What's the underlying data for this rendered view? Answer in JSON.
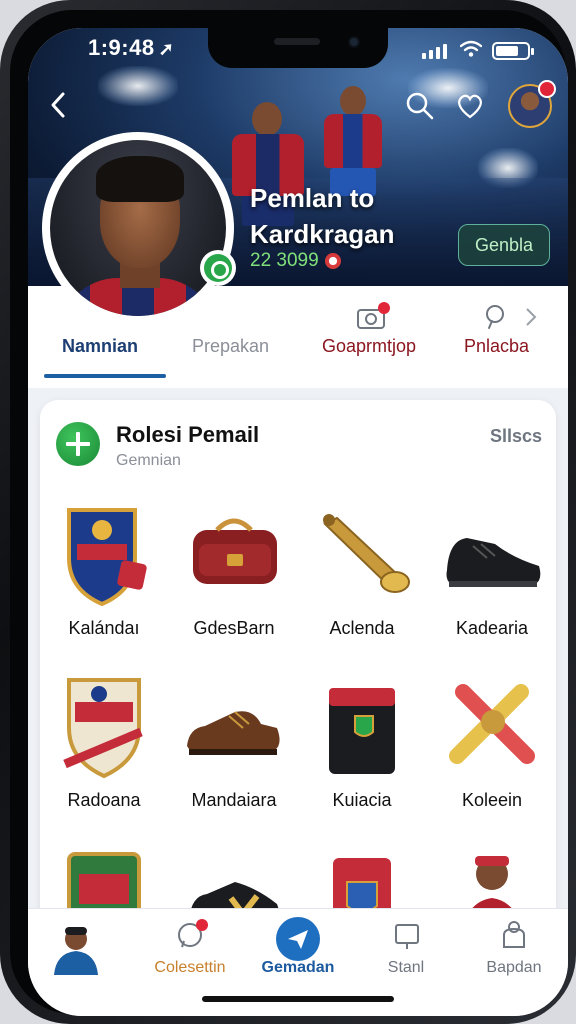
{
  "status_bar": {
    "time": "1:9:48",
    "nav_arrow": "➚"
  },
  "header": {
    "title_line1": "Pemlan to",
    "title_line2": "Kardkragan",
    "stat_value": "22 3099",
    "follow_label": "Genbla",
    "icons": [
      "back-icon",
      "search-icon",
      "heart-search-icon",
      "avatar-icon"
    ],
    "accent_color": "#1c5fa3"
  },
  "tabs": [
    {
      "label": "Namnian",
      "active": true,
      "color": "#1d3f74"
    },
    {
      "label": "Prepakan",
      "active": false,
      "color": "#8a8f98"
    },
    {
      "label": "Goaprmtjop",
      "active": false,
      "color": "#8b1620"
    },
    {
      "label": "Pnlacba",
      "active": false,
      "color": "#8b1620"
    }
  ],
  "card": {
    "title": "Rolesi Pemail",
    "subtitle": "Gemnian",
    "link": "Sllscs",
    "items": [
      {
        "label": "Kalándaı",
        "icon": "crest-shield-icon"
      },
      {
        "label": "GdesBarn",
        "icon": "leather-bag-icon"
      },
      {
        "label": "Aclenda",
        "icon": "bronze-horn-icon"
      },
      {
        "label": "Kadearia",
        "icon": "black-sneaker-icon"
      },
      {
        "label": "Radoana",
        "icon": "red-shield-icon"
      },
      {
        "label": "Mandaiara",
        "icon": "brown-boot-icon"
      },
      {
        "label": "Kuiacia",
        "icon": "black-bag-icon"
      },
      {
        "label": "Koleein",
        "icon": "crossed-scrolls-icon"
      },
      {
        "label": "",
        "icon": "green-badge-icon"
      },
      {
        "label": "",
        "icon": "black-cleat-icon"
      },
      {
        "label": "",
        "icon": "red-box-icon"
      },
      {
        "label": "",
        "icon": "player-figure-icon"
      }
    ]
  },
  "bottom_nav": [
    {
      "label": "",
      "icon": "player-avatar-icon"
    },
    {
      "label": "Colesettin",
      "icon": "chat-bubble-icon",
      "color": "#c7802b"
    },
    {
      "label": "Gemadan",
      "icon": "send-icon",
      "color": "#1d5a9f"
    },
    {
      "label": "Stanl",
      "icon": "message-square-icon",
      "color": "#6f7680"
    },
    {
      "label": "Bapdan",
      "icon": "lock-bag-icon",
      "color": "#6f7680"
    }
  ]
}
